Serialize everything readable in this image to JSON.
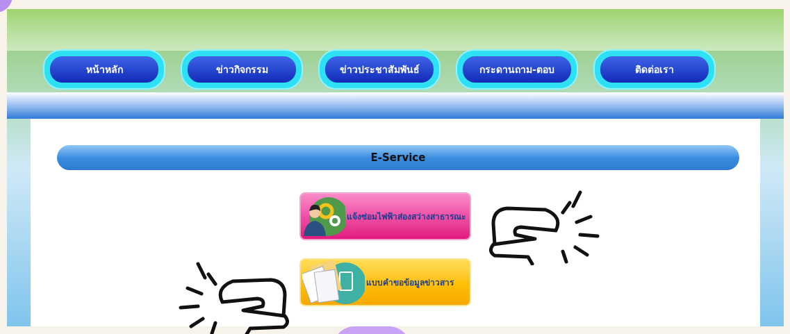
{
  "nav": [
    {
      "label": "หน้าหลัก"
    },
    {
      "label": "ข่าวกิจกรรม"
    },
    {
      "label": "ข่าวประชาสัมพันธ์"
    },
    {
      "label": "กระดานถาม-ตอบ"
    },
    {
      "label": "ติดต่อเรา"
    }
  ],
  "section_title": "E-Service",
  "services": [
    {
      "label": "แจ้งซ่อมไฟฟ้าส่องสว่างสาธารณะ",
      "kind": "repair"
    },
    {
      "label": "แบบคำขอข้อมูลข่าวสาร",
      "kind": "request"
    }
  ]
}
